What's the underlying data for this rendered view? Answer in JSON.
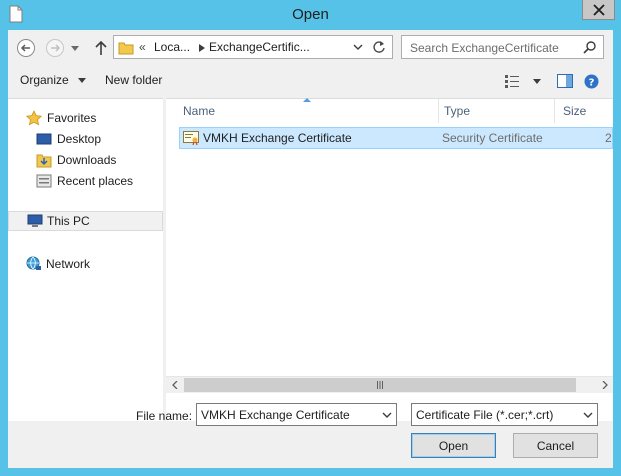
{
  "window": {
    "title": "Open"
  },
  "address": {
    "overflow": "«",
    "crumbs": [
      "Loca...",
      "ExchangeCertific..."
    ]
  },
  "search": {
    "placeholder": "Search ExchangeCertificate"
  },
  "toolbar": {
    "organize": "Organize",
    "new_folder": "New folder"
  },
  "nav": {
    "favorites": "Favorites",
    "desktop": "Desktop",
    "downloads": "Downloads",
    "recent": "Recent places",
    "this_pc": "This PC",
    "network": "Network"
  },
  "columns": {
    "name": "Name",
    "type": "Type",
    "size": "Size"
  },
  "files": [
    {
      "name": "VMKH Exchange Certificate",
      "type": "Security Certificate",
      "size": "2"
    }
  ],
  "bottom": {
    "file_name_label": "File name:",
    "file_name_value": "VMKH Exchange Certificate",
    "file_type": "Certificate File (*.cer;*.crt)",
    "open": "Open",
    "cancel": "Cancel"
  },
  "colors": {
    "frame": "#57c2e8",
    "selection": "#cce8ff",
    "selection_border": "#99d1ff"
  }
}
